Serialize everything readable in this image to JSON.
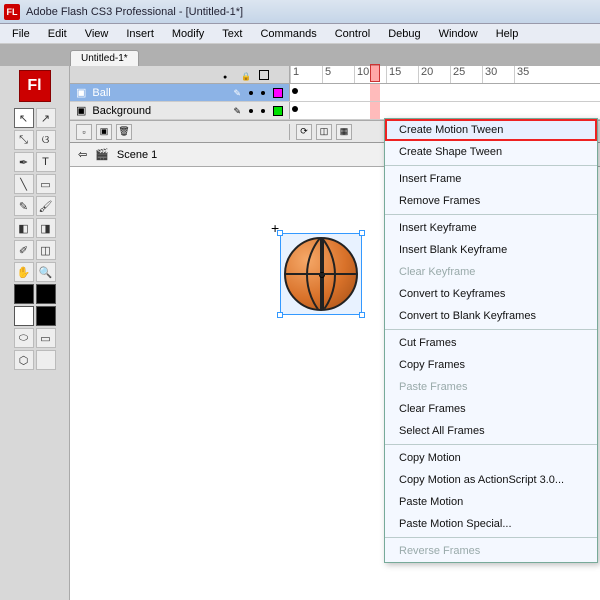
{
  "title": "Adobe Flash CS3 Professional - [Untitled-1*]",
  "menus": [
    "File",
    "Edit",
    "View",
    "Insert",
    "Modify",
    "Text",
    "Commands",
    "Control",
    "Debug",
    "Window",
    "Help"
  ],
  "doc_tab": "Untitled-1*",
  "ruler": [
    "1",
    "5",
    "10",
    "15",
    "20",
    "25",
    "30",
    "35"
  ],
  "layers": [
    {
      "name": "Ball",
      "selected": true,
      "swatch": "#ff00ff"
    },
    {
      "name": "Background",
      "selected": false,
      "swatch": "#00e000"
    }
  ],
  "scene": "Scene 1",
  "context_menu": [
    {
      "label": "Create Motion Tween",
      "type": "item",
      "hl": true
    },
    {
      "label": "Create Shape Tween",
      "type": "item"
    },
    {
      "type": "sep"
    },
    {
      "label": "Insert Frame",
      "type": "item"
    },
    {
      "label": "Remove Frames",
      "type": "item"
    },
    {
      "type": "sep"
    },
    {
      "label": "Insert Keyframe",
      "type": "item"
    },
    {
      "label": "Insert Blank Keyframe",
      "type": "item"
    },
    {
      "label": "Clear Keyframe",
      "type": "item",
      "disabled": true
    },
    {
      "label": "Convert to Keyframes",
      "type": "item"
    },
    {
      "label": "Convert to Blank Keyframes",
      "type": "item"
    },
    {
      "type": "sep"
    },
    {
      "label": "Cut Frames",
      "type": "item"
    },
    {
      "label": "Copy Frames",
      "type": "item"
    },
    {
      "label": "Paste Frames",
      "type": "item",
      "disabled": true
    },
    {
      "label": "Clear Frames",
      "type": "item"
    },
    {
      "label": "Select All Frames",
      "type": "item"
    },
    {
      "type": "sep"
    },
    {
      "label": "Copy Motion",
      "type": "item"
    },
    {
      "label": "Copy Motion as ActionScript 3.0...",
      "type": "item"
    },
    {
      "label": "Paste Motion",
      "type": "item"
    },
    {
      "label": "Paste Motion Special...",
      "type": "item"
    },
    {
      "type": "sep"
    },
    {
      "label": "Reverse Frames",
      "type": "item",
      "disabled": true
    }
  ]
}
